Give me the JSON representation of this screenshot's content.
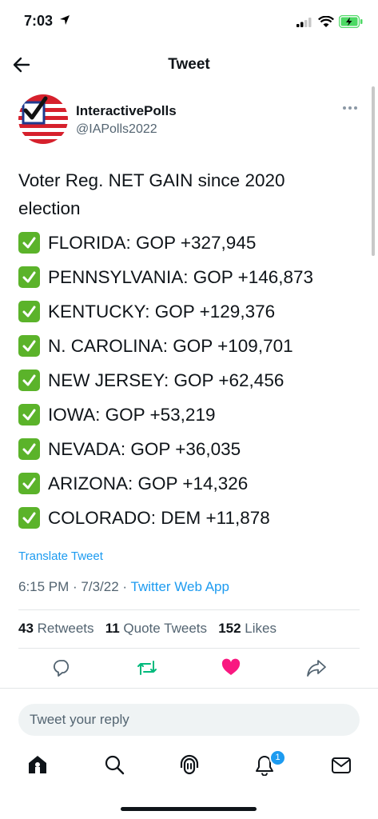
{
  "status": {
    "time": "7:03"
  },
  "header": {
    "title": "Tweet"
  },
  "author": {
    "name": "InteractivePolls",
    "handle": "@IAPolls2022"
  },
  "tweet": {
    "intro": "Voter Reg. NET GAIN since 2020 election",
    "lines": [
      "FLORIDA: GOP +327,945",
      "PENNSYLVANIA: GOP +146,873",
      "KENTUCKY: GOP +129,376",
      "N. CAROLINA: GOP +109,701",
      "NEW JERSEY: GOP +62,456",
      "IOWA: GOP +53,219",
      "NEVADA: GOP +36,035",
      "ARIZONA: GOP +14,326",
      "COLORADO: DEM +11,878"
    ],
    "translate": "Translate Tweet",
    "time": "6:15 PM",
    "date": "7/3/22",
    "source": "Twitter Web App"
  },
  "stats": {
    "retweets": "43",
    "retweets_label": "Retweets",
    "quotes": "11",
    "quotes_label": "Quote Tweets",
    "likes": "152",
    "likes_label": "Likes"
  },
  "actions": {
    "reply_icon": "reply-icon",
    "retweet_icon": "retweet-icon",
    "like_icon": "heart-icon",
    "share_icon": "share-icon"
  },
  "reply": {
    "placeholder": "Tweet your reply"
  },
  "nav": {
    "notifications_badge": "1"
  },
  "colors": {
    "accent": "#1d9bf0",
    "retweet": "#00ba7c",
    "like": "#f91880",
    "check": "#5bb32a"
  }
}
